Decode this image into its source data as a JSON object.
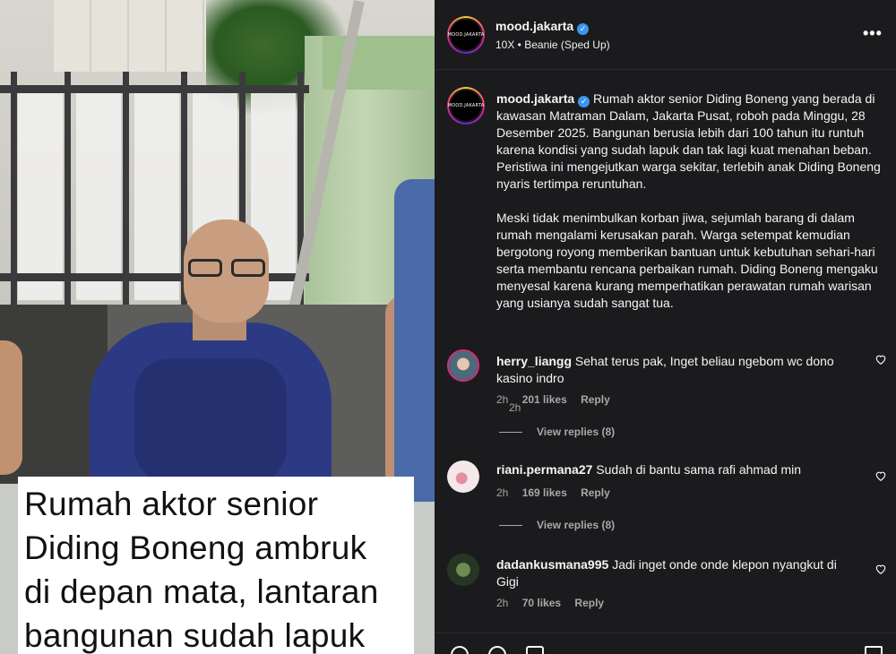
{
  "media": {
    "overlay_caption_lines": [
      "Rumah aktor senior",
      "Diding Boneng ambruk",
      "di depan mata, lantaran",
      "bangunan sudah lapuk"
    ]
  },
  "post": {
    "username": "mood.jakarta",
    "verified": true,
    "avatar_logo_text": "MOOD.JAKARTA",
    "audio_track": "10X • Beanie (Sped Up)",
    "more_icon": "more-horizontal-icon",
    "caption_paragraphs": [
      "Rumah aktor senior Diding Boneng yang berada di kawasan Matraman Dalam, Jakarta Pusat, roboh pada Minggu, 28 Desember 2025. Bangunan berusia lebih dari 100 tahun itu runtuh karena kondisi yang sudah lapuk dan tak lagi kuat menahan beban. Peristiwa ini mengejutkan warga sekitar, terlebih anak Diding Boneng nyaris tertimpa reruntuhan.",
      "Meski tidak menimbulkan korban jiwa, sejumlah barang di dalam rumah mengalami kerusakan parah. Warga setempat kemudian bergotong royong memberikan bantuan untuk kebutuhan sehari-hari serta membantu rencana perbaikan rumah. Diding Boneng mengaku menyesal karena kurang memperhatikan perawatan rumah warisan yang usianya sudah sangat tua."
    ],
    "caption_time": "2h"
  },
  "comments": [
    {
      "username": "herry_liangg",
      "text": "Sehat terus pak, Inget beliau ngebom wc dono kasino indro",
      "time": "2h",
      "likes": "201 likes",
      "reply_label": "Reply",
      "view_replies": "View replies (8)"
    },
    {
      "username": "riani.permana27",
      "text": "Sudah di bantu sama rafi ahmad min",
      "time": "2h",
      "likes": "169 likes",
      "reply_label": "Reply",
      "view_replies": "View replies (8)"
    },
    {
      "username": "dadankusmana995",
      "text": "Jadi inget onde onde klepon nyangkut di Gigi",
      "time": "2h",
      "likes": "70 likes",
      "reply_label": "Reply"
    }
  ],
  "colors": {
    "panel_bg": "#1b1b1d",
    "text_primary": "#f5f5f5",
    "text_secondary": "#a8a8a8",
    "verified_blue": "#3897f0"
  }
}
